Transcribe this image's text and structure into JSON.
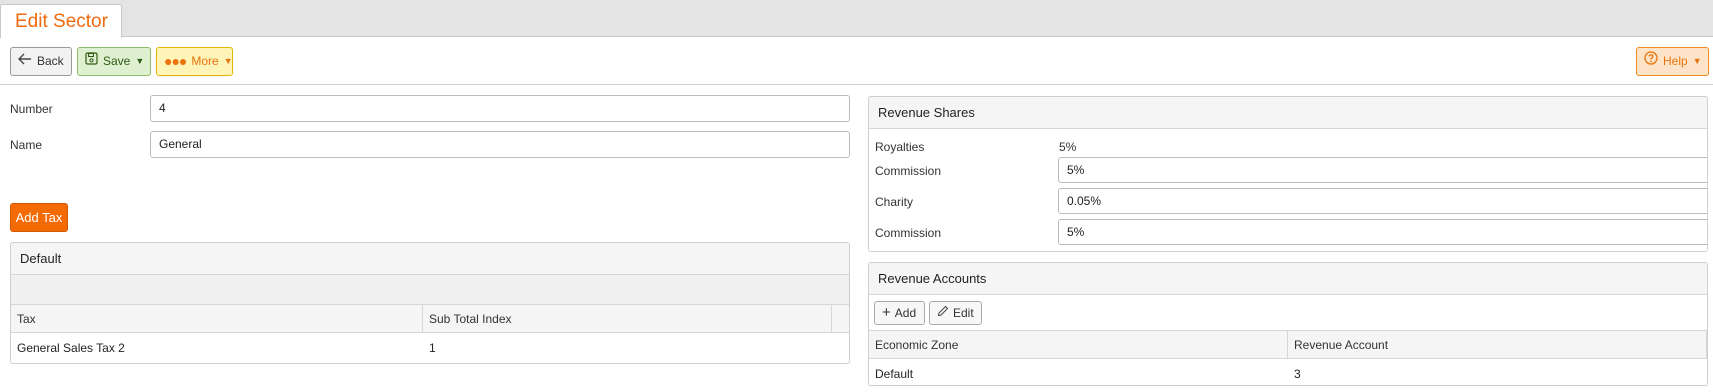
{
  "tab": {
    "title": "Edit Sector"
  },
  "toolbar": {
    "back_label": "Back",
    "save_label": "Save",
    "more_label": "More",
    "help_label": "Help"
  },
  "form": {
    "number_label": "Number",
    "number_value": "4",
    "name_label": "Name",
    "name_value": "General"
  },
  "add_tax_label": "Add Tax",
  "tax_panel": {
    "title": "Default",
    "columns": [
      "Tax",
      "Sub Total Index"
    ],
    "rows": [
      [
        "General Sales Tax 2",
        "1"
      ]
    ]
  },
  "revenue_shares": {
    "title": "Revenue Shares",
    "royalties_label": "Royalties",
    "royalties_value": "5%",
    "items": [
      {
        "label": "Commission",
        "value": "5%"
      },
      {
        "label": "Charity",
        "value": "0.05%"
      },
      {
        "label": "Commission",
        "value": "5%"
      }
    ]
  },
  "revenue_accounts": {
    "title": "Revenue Accounts",
    "add_label": "Add",
    "edit_label": "Edit",
    "columns": [
      "Economic Zone",
      "Revenue Account"
    ],
    "rows": [
      [
        "Default",
        "3"
      ]
    ]
  },
  "colors": {
    "accent": "#f06a0f",
    "save_bg": "#dff0d0",
    "more_bg": "#fff4b8",
    "help_bg": "#fde4c8",
    "add_tax_bg": "#f46b06"
  }
}
